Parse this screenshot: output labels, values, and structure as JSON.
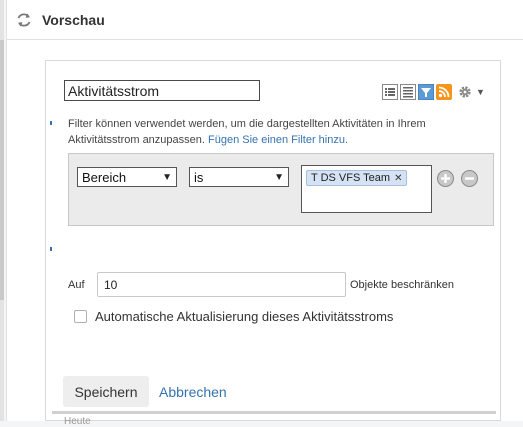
{
  "header": {
    "title": "Vorschau"
  },
  "gadget": {
    "title_value": "Aktivitätsstrom",
    "filter_hint": "Filter können verwendet werden, um die dargestellten Aktivitäten in Ihrem Aktivitätsstrom anzupassen.",
    "filter_link": "Fügen Sie einen Filter hinzu.",
    "filter": {
      "field": "Bereich",
      "operator": "is",
      "tags": [
        "T DS VFS Team"
      ]
    },
    "limit": {
      "prefix": "Auf",
      "value": "10",
      "suffix": "Objekte beschränken"
    },
    "auto_refresh_label": "Automatische Aktualisierung dieses Aktivitätsstroms",
    "save_label": "Speichern",
    "cancel_label": "Abbrechen",
    "bottom_cut_text": "Heute",
    "toolbar_icons": [
      "list-view-icon",
      "detailed-view-icon",
      "filter-icon",
      "rss-feed-icon",
      "gear-icon"
    ]
  },
  "colors": {
    "link": "#3572b0",
    "tag_bg": "#d4e2f4",
    "rss": "#f7941d",
    "filter_active": "#5b9bd5"
  }
}
